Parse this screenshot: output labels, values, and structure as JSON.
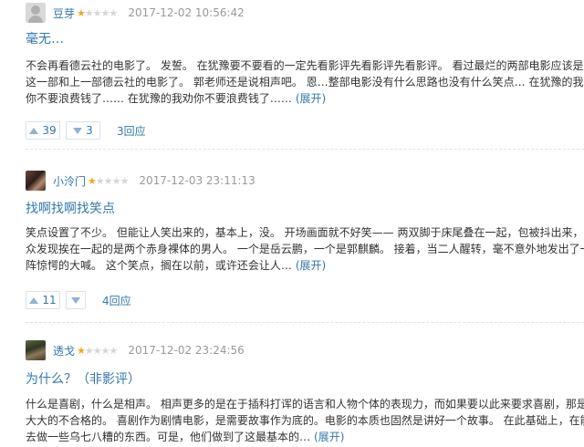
{
  "colors": {
    "link": "#3377aa",
    "star": "#f5a623",
    "meta": "#999999"
  },
  "reviews": [
    {
      "username": "豆芽",
      "rating_stars": 1,
      "time": "2017-12-02 10:56:42",
      "title": "毫无…",
      "lines": [
        "不会再看德云社的电影了。 发誓。 在犹豫要不要看的一定先看影评先看影评先看影评。 看过最烂的两部电影应该是",
        "这一部和上一部德云社的电影了。 郭老师还是说相声吧。 恩…整部电影没有什么思路也没有什么笑点… 在犹豫的我劝",
        "你不要浪费钱了…… 在犹豫的我劝你不要浪费钱了……"
      ],
      "expand_label": "(展开)",
      "useful": "39",
      "useless": "3",
      "reply_label": "3回应"
    },
    {
      "username": "小泠门",
      "rating_stars": 1,
      "time": "2017-12-03 23:11:13",
      "title": "找啊找啊找笑点",
      "lines": [
        "笑点设置了不少。 但能让人笑出来的，基本上，没。 开场画面就不好笑—— 两双脚于床尾叠在一起，包被抖出来，观",
        "众发现挨在一起的是两个赤身裸体的男人。 一个是岳云鹏，一个是郭麒麟。 接着，当二人醒转，毫不意外地发出了一",
        "阵惊愕的大喊。 这个笑点，搁在以前，或许还会让人…"
      ],
      "expand_label": "(展开)",
      "useful": "11",
      "useless": "",
      "reply_label": "4回应"
    },
    {
      "username": "透戈",
      "rating_stars": 1,
      "time": "2017-12-02 23:24:56",
      "title": "为什么？（非影评）",
      "lines": [
        "什么是喜剧，什么是相声。 相声更多的是在于插科打诨的语言和人物个体的表现力，而如果要以此来要求喜剧，那是",
        "大大的不合格的。 喜剧作为剧情电影，是需要故事作为底的。电影的本质也固然是讲好一个故事。 在此基础上，在能",
        "去做一些乌七八糟的东西。可是，他们做到了这最基本的…"
      ],
      "expand_label": "(展开)"
    }
  ]
}
